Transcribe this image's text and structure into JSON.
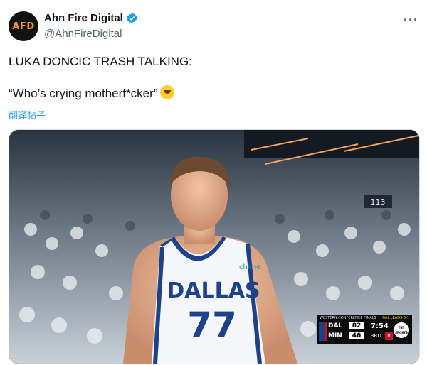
{
  "author": {
    "display_name": "Ahn Fire Digital",
    "handle": "@AhnFireDigital",
    "avatar_text": "AFD"
  },
  "tweet": {
    "line1": "LUKA DONCIC TRASH TALKING:",
    "line2": "“Who’s crying motherf*cker”",
    "translate_label": "翻译帖子"
  },
  "more_menu": "···",
  "media": {
    "jersey_team": "DALLAS",
    "jersey_number": "77",
    "jersey_sponsor": "chime",
    "section_sign": "113",
    "scoreboard": {
      "header_left": "WESTERN CONFERENCE FINALS",
      "header_right": "DAL LEADS 3-1",
      "team1": "DAL",
      "score1": "82",
      "team2": "MIN",
      "score2": "46",
      "clock": "7:54",
      "period": "3RD",
      "shot_clock": "8",
      "network": "TNT SPORTS"
    }
  },
  "colors": {
    "link": "#1d9bf0",
    "verified": "#1d9bf0",
    "mavs_blue": "#1d428a"
  }
}
